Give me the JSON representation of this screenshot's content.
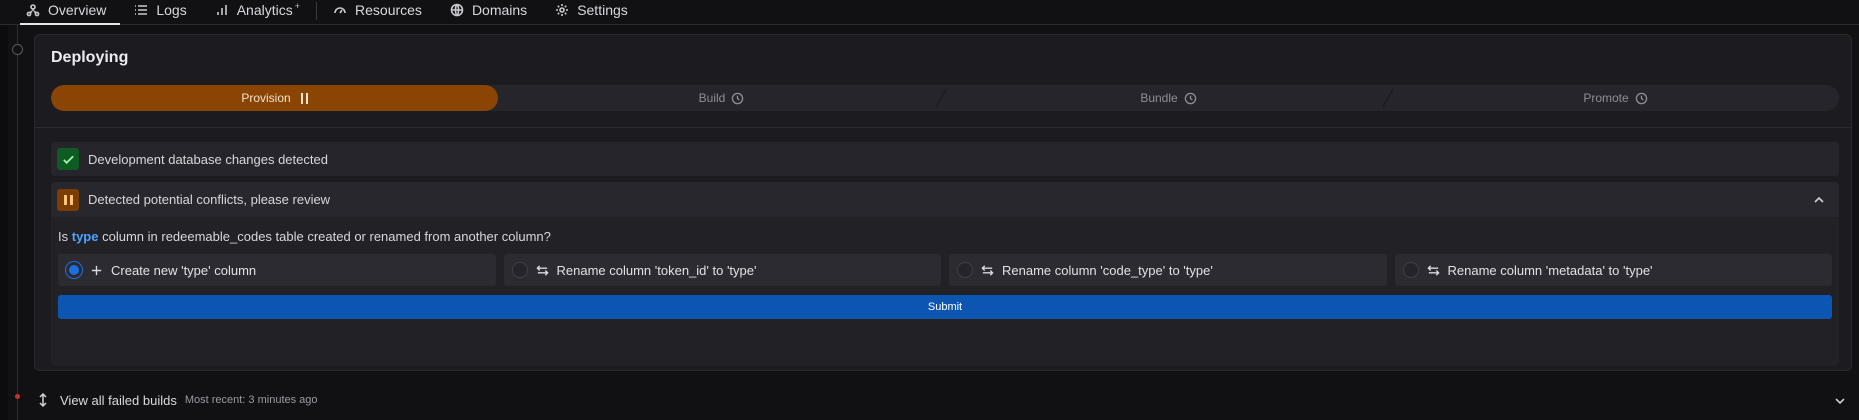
{
  "nav": {
    "tabs": [
      {
        "label": "Overview",
        "icon": "graph-icon",
        "active": true
      },
      {
        "label": "Logs",
        "icon": "list-icon"
      },
      {
        "label": "Analytics",
        "icon": "bar-chart-icon",
        "superscript": "+"
      },
      {
        "label": "Resources",
        "icon": "gauge-icon"
      },
      {
        "label": "Domains",
        "icon": "globe-icon"
      },
      {
        "label": "Settings",
        "icon": "gear-icon"
      }
    ]
  },
  "deploy": {
    "title": "Deploying",
    "steps": [
      {
        "label": "Provision",
        "status": "paused"
      },
      {
        "label": "Build",
        "status": "pending"
      },
      {
        "label": "Bundle",
        "status": "pending"
      },
      {
        "label": "Promote",
        "status": "pending"
      }
    ]
  },
  "checks": {
    "success_text": "Development database changes detected",
    "conflict_title": "Detected potential conflicts, please review",
    "question_prefix": "Is",
    "question_highlight": "type",
    "question_suffix": "column in redeemable_codes table created or renamed from another column?",
    "options": [
      {
        "label": "Create new 'type' column",
        "icon": "plus-icon",
        "selected": true
      },
      {
        "label": "Rename column 'token_id' to 'type'",
        "icon": "swap-icon",
        "selected": false
      },
      {
        "label": "Rename column 'code_type' to 'type'",
        "icon": "swap-icon",
        "selected": false
      },
      {
        "label": "Rename column 'metadata' to 'type'",
        "icon": "swap-icon",
        "selected": false
      }
    ],
    "submit_label": "Submit"
  },
  "failed": {
    "label": "View all failed builds",
    "recent": "Most recent: 3 minutes ago"
  },
  "colors": {
    "accent_blue": "#0c56b2",
    "provision_orange": "#8a4505",
    "success_green": "#0f5b23",
    "highlight_blue": "#4aa3ff",
    "error_red": "#d02b2b"
  }
}
